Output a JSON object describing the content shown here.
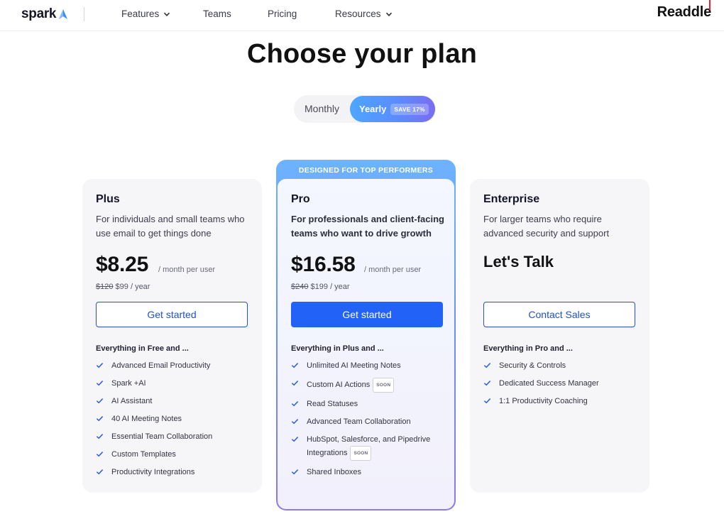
{
  "nav": {
    "logo": "spark",
    "features": "Features",
    "teams": "Teams",
    "pricing": "Pricing",
    "resources": "Resources",
    "brand": "Readdle"
  },
  "title": "Choose your plan",
  "toggle": {
    "monthly": "Monthly",
    "yearly": "Yearly",
    "save": "SAVE 17%"
  },
  "plans": {
    "plus": {
      "name": "Plus",
      "desc": "For individuals and small teams who use email to get things done",
      "price": "$8.25",
      "unit": "/ month per user",
      "old_price": "$120",
      "year_price": "$99 / year",
      "cta": "Get started",
      "features_head": "Everything in Free and ...",
      "features": [
        "Advanced Email Productivity",
        "Spark +AI",
        "AI Assistant",
        "40 AI Meeting Notes",
        "Essential Team Collaboration",
        "Custom Templates",
        "Productivity Integrations"
      ]
    },
    "pro": {
      "banner": "DESIGNED FOR TOP PERFORMERS",
      "name": "Pro",
      "desc": "For professionals and client-facing teams who want to drive growth",
      "price": "$16.58",
      "unit": "/ month per user",
      "old_price": "$240",
      "year_price": "$199 / year",
      "cta": "Get started",
      "features_head": "Everything in Plus and ...",
      "features": [
        "Unlimited AI Meeting Notes",
        "Custom AI Actions",
        "Read Statuses",
        "Advanced Team Collaboration",
        "HubSpot, Salesforce, and Pipedrive Integrations",
        "Shared Inboxes"
      ],
      "soon": "SOON"
    },
    "enterprise": {
      "name": "Enterprise",
      "desc": "For larger teams who require advanced security and support",
      "price_text": "Let's Talk",
      "cta": "Contact Sales",
      "features_head": "Everything in Pro and ...",
      "features": [
        "Security & Controls",
        "Dedicated Success Manager",
        "1:1 Productivity Coaching"
      ]
    }
  },
  "colors": {
    "accent": "#2262f7",
    "check": "#2a5bd7"
  }
}
